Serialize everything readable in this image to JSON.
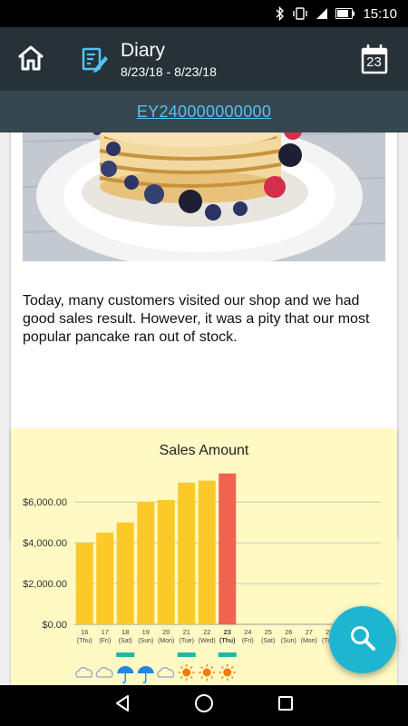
{
  "status_bar": {
    "time": "15:10"
  },
  "app_bar": {
    "title": "Diary",
    "date_range": "8/23/18 - 8/23/18",
    "calendar_day": "23"
  },
  "id_link": "EY240000000000",
  "diary_entry": {
    "text": "Today, many customers visited our shop and we had good sales result. However, it was a pity that our most popular pancake ran out of stock."
  },
  "colors": {
    "bar_normal": "#fcca28",
    "bar_highlight": "#ef6351",
    "chart_bg": "#fff9c4",
    "fab": "#1eb5d0",
    "rain_icon": "#1e88e5",
    "sun_icon": "#f57c00",
    "teal_marker": "#1db9a6"
  },
  "chart_data": {
    "type": "bar",
    "title": "Sales Amount",
    "ylim": [
      0,
      7300
    ],
    "yticks": [
      "$0.00",
      "$2,000.00",
      "$4,000.00",
      "$6,000.00"
    ],
    "ytick_values": [
      0,
      2000,
      4000,
      6000
    ],
    "categories": [
      {
        "day": "16",
        "dow": "(Thu)"
      },
      {
        "day": "17",
        "dow": "(Fri)"
      },
      {
        "day": "18",
        "dow": "(Sat)"
      },
      {
        "day": "19",
        "dow": "(Sun)"
      },
      {
        "day": "20",
        "dow": "(Mon)"
      },
      {
        "day": "21",
        "dow": "(Tue)"
      },
      {
        "day": "22",
        "dow": "(Wed)"
      },
      {
        "day": "23",
        "dow": "(Thu)"
      },
      {
        "day": "24",
        "dow": "(Fri)"
      },
      {
        "day": "25",
        "dow": "(Sat)"
      },
      {
        "day": "26",
        "dow": "(Sun)"
      },
      {
        "day": "27",
        "dow": "(Mon)"
      },
      {
        "day": "28",
        "dow": "(Tue)"
      }
    ],
    "values": [
      4000,
      4500,
      5000,
      6000,
      6100,
      6950,
      7050,
      7400,
      null,
      null,
      null,
      null,
      null
    ],
    "highlight_index": 7,
    "markers": [
      false,
      false,
      true,
      false,
      false,
      true,
      false,
      true,
      false,
      false,
      false,
      false,
      false
    ],
    "weather": [
      "cloud",
      "cloud",
      "umbrella",
      "umbrella",
      "cloud",
      "sun",
      "sun",
      "sun",
      "",
      "",
      "",
      "",
      ""
    ],
    "grid": true
  }
}
